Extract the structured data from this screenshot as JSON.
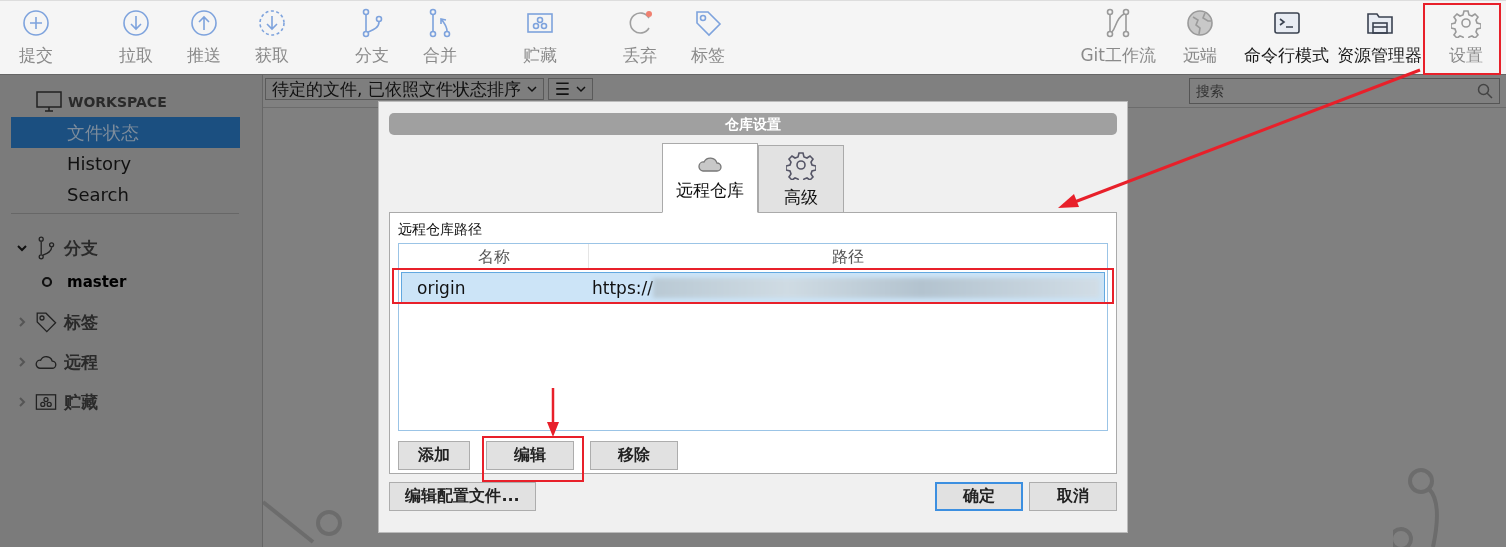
{
  "toolbar_left": [
    [
      {
        "label": "提交",
        "kind": "commit",
        "disabled": true
      }
    ],
    [
      {
        "label": "拉取",
        "kind": "pull",
        "disabled": true
      },
      {
        "label": "推送",
        "kind": "push",
        "disabled": true
      },
      {
        "label": "获取",
        "kind": "fetch",
        "disabled": true
      }
    ],
    [
      {
        "label": "分支",
        "kind": "branch",
        "disabled": true
      },
      {
        "label": "合并",
        "kind": "merge",
        "disabled": true
      }
    ],
    [
      {
        "label": "贮藏",
        "kind": "stash",
        "disabled": true
      }
    ],
    [
      {
        "label": "丢弃",
        "kind": "discard",
        "disabled": true
      },
      {
        "label": "标签",
        "kind": "tag",
        "disabled": true
      }
    ]
  ],
  "toolbar_right": [
    {
      "label": "Git工作流",
      "kind": "gitflow",
      "disabled": true
    },
    {
      "label": "远端",
      "kind": "remote",
      "disabled": true
    },
    {
      "label": "命令行模式",
      "kind": "terminal",
      "disabled": false
    },
    {
      "label": "资源管理器",
      "kind": "explorer",
      "disabled": false
    },
    {
      "label": "设置",
      "kind": "settings",
      "disabled": true
    }
  ],
  "sidebar": {
    "workspace": {
      "title": "WORKSPACE",
      "items": [
        {
          "label": "文件状态",
          "selected": true
        },
        {
          "label": "History",
          "selected": false
        },
        {
          "label": "Search",
          "selected": false
        }
      ]
    },
    "sections": [
      {
        "label": "分支",
        "kind": "branch",
        "expanded": true,
        "children": [
          {
            "label": "master"
          }
        ]
      },
      {
        "label": "标签",
        "kind": "tag",
        "expanded": false
      },
      {
        "label": "远程",
        "kind": "remote",
        "expanded": false
      },
      {
        "label": "贮藏",
        "kind": "stash",
        "expanded": false
      }
    ]
  },
  "file_bar": {
    "sort_dropdown": "待定的文件, 已依照文件状态排序",
    "view_button": "☰",
    "search": {
      "placeholder": "搜索"
    }
  },
  "dialog": {
    "title": "仓库设置",
    "tabs": [
      {
        "label": "远程仓库",
        "kind": "remote",
        "selected": true
      },
      {
        "label": "高级",
        "kind": "settings",
        "selected": false
      }
    ],
    "section_label": "远程仓库路径",
    "columns": [
      "名称",
      "路径"
    ],
    "rows": [
      {
        "name": "origin",
        "path": "https://",
        "selected": true
      }
    ],
    "list_buttons": [
      "添加",
      "编辑",
      "移除"
    ],
    "edit_config_button": "编辑配置文件...",
    "ok_button": "确定",
    "cancel_button": "取消"
  }
}
